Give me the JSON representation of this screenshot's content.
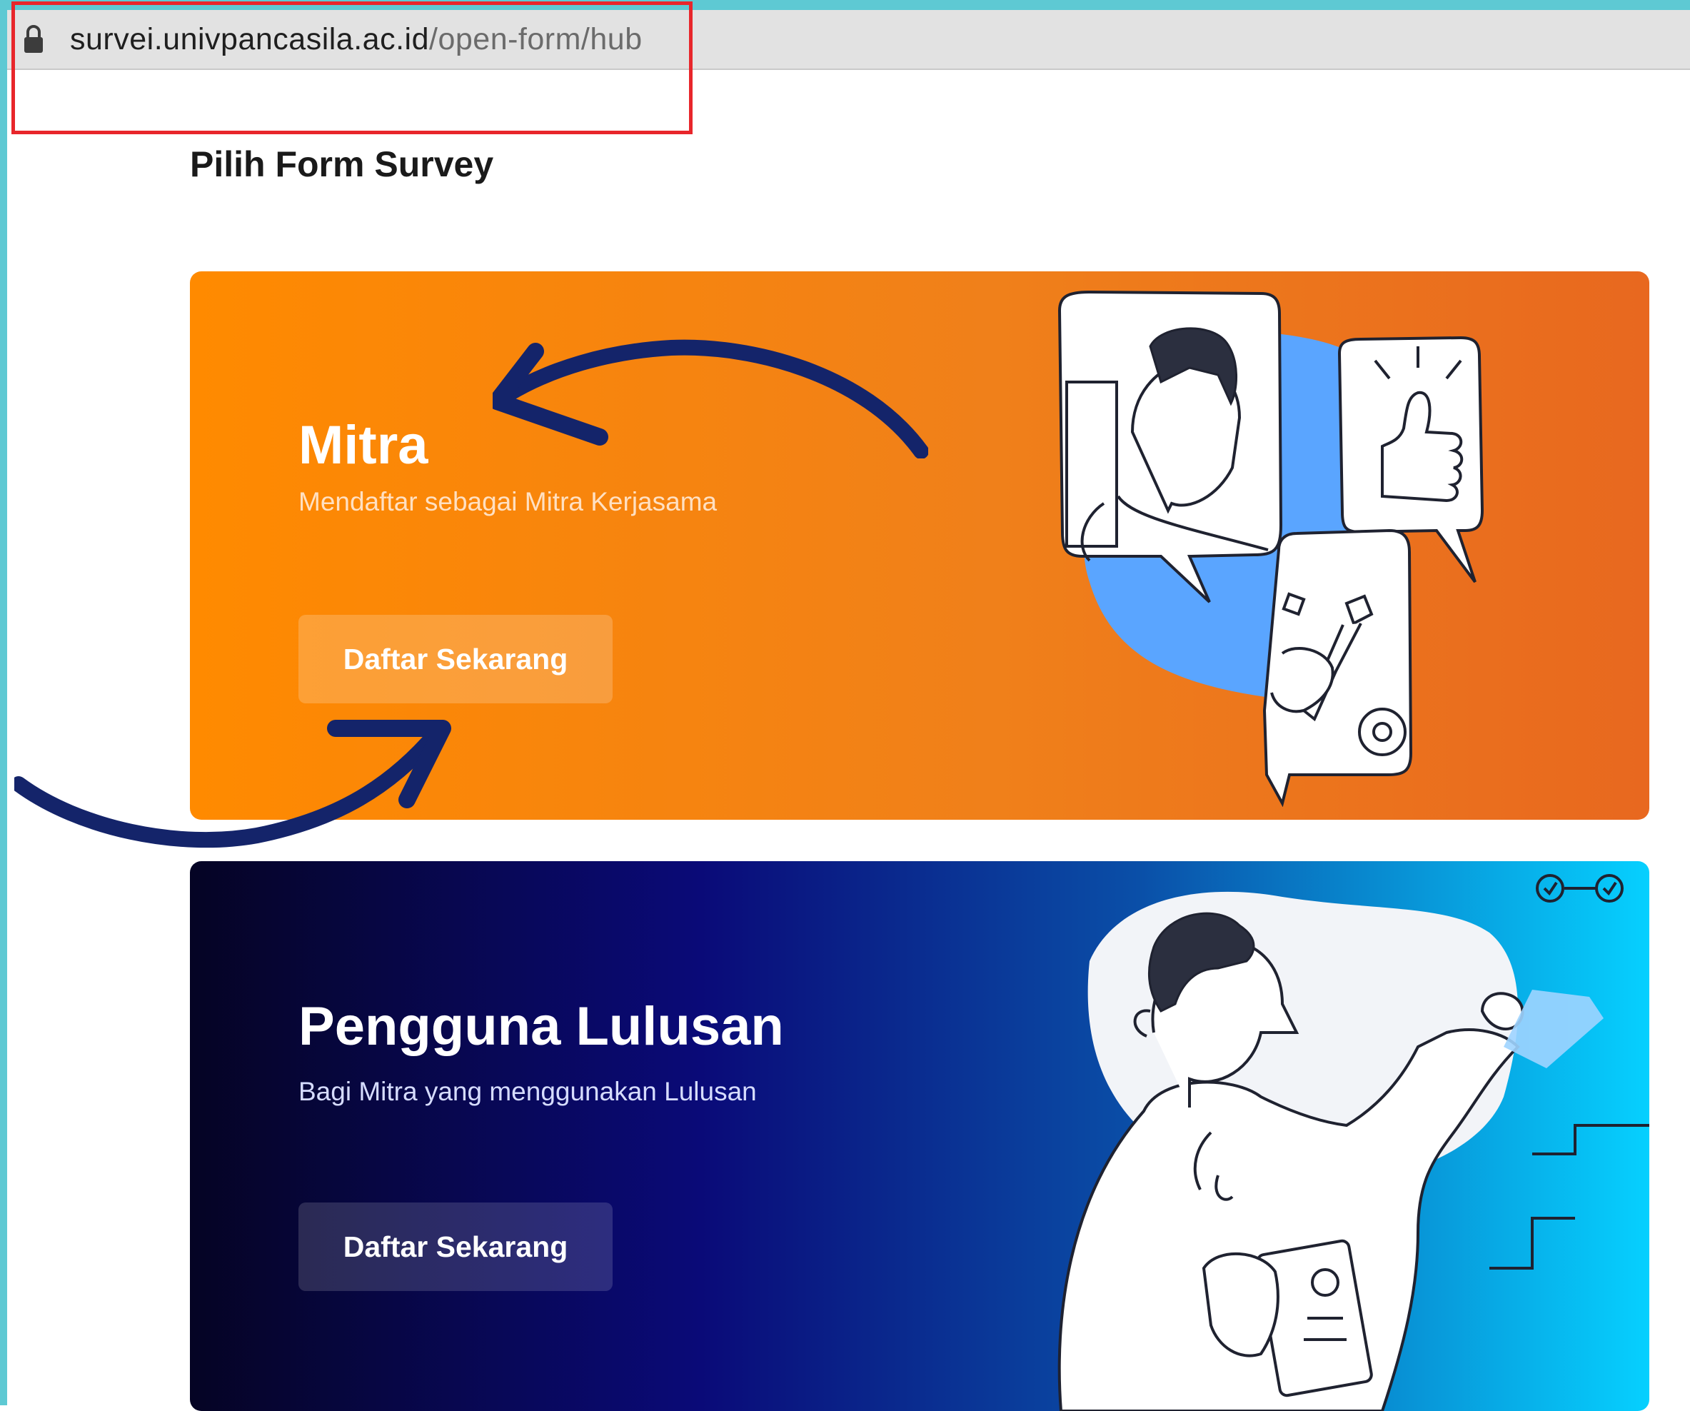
{
  "browser": {
    "url_host": "survei.univpancasila.ac.id",
    "url_path": "/open-form/hub"
  },
  "page": {
    "title": "Pilih Form Survey"
  },
  "cards": [
    {
      "title": "Mitra",
      "subtitle": "Mendaftar sebagai Mitra Kerjasama",
      "button_label": "Daftar Sekarang"
    },
    {
      "title": "Pengguna Lulusan",
      "subtitle": "Bagi Mitra yang menggunakan Lulusan",
      "button_label": "Daftar Sekarang"
    }
  ],
  "icons": [
    "lock-icon",
    "curved-arrow-icon"
  ],
  "colors": {
    "annotation_red": "#e8262b",
    "arrow_navy": "#14246a",
    "mitra_orange": "#ff8a00",
    "pengguna_navy": "#0a0a78",
    "pengguna_cyan": "#06d0ff",
    "illustration_blue": "#5aa5ff"
  }
}
